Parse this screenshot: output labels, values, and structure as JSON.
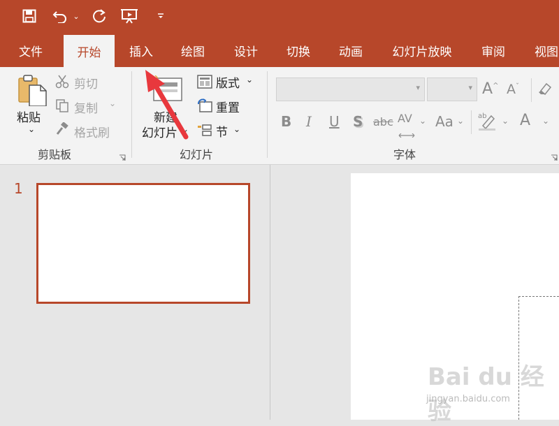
{
  "quick_access": {
    "save_icon": "save-icon",
    "undo_icon": "undo-icon",
    "redo_icon": "redo-icon",
    "present_icon": "start-from-beginning-icon",
    "customize_icon": "customize-qat-icon"
  },
  "tabs": [
    {
      "label": "文件"
    },
    {
      "label": "开始"
    },
    {
      "label": "插入"
    },
    {
      "label": "绘图"
    },
    {
      "label": "设计"
    },
    {
      "label": "切换"
    },
    {
      "label": "动画"
    },
    {
      "label": "幻灯片放映"
    },
    {
      "label": "审阅"
    },
    {
      "label": "视图"
    }
  ],
  "active_tab": "开始",
  "clipboard": {
    "group_label": "剪贴板",
    "paste_label": "粘贴",
    "cut_label": "剪切",
    "copy_label": "复制",
    "format_painter_label": "格式刷"
  },
  "slides_group": {
    "group_label": "幻灯片",
    "new_slide_line1": "新建",
    "new_slide_line2": "幻灯片",
    "layout_label": "版式",
    "reset_label": "重置",
    "section_label": "节"
  },
  "font_group": {
    "group_label": "字体",
    "font_name_value": "",
    "font_size_value": "",
    "grow_font": "A",
    "shrink_font": "A",
    "bold": "B",
    "italic": "I",
    "underline": "U",
    "shadow": "S",
    "strikethrough": "abc",
    "char_spacing": "AV",
    "change_case": "Aa",
    "font_color": "A"
  },
  "thumbnails": [
    {
      "number": "1"
    }
  ],
  "watermark": {
    "text": "Bai du 经验",
    "url": "jingyan.baidu.com"
  },
  "colors": {
    "accent": "#b7472a",
    "arrow": "#e8383d"
  }
}
